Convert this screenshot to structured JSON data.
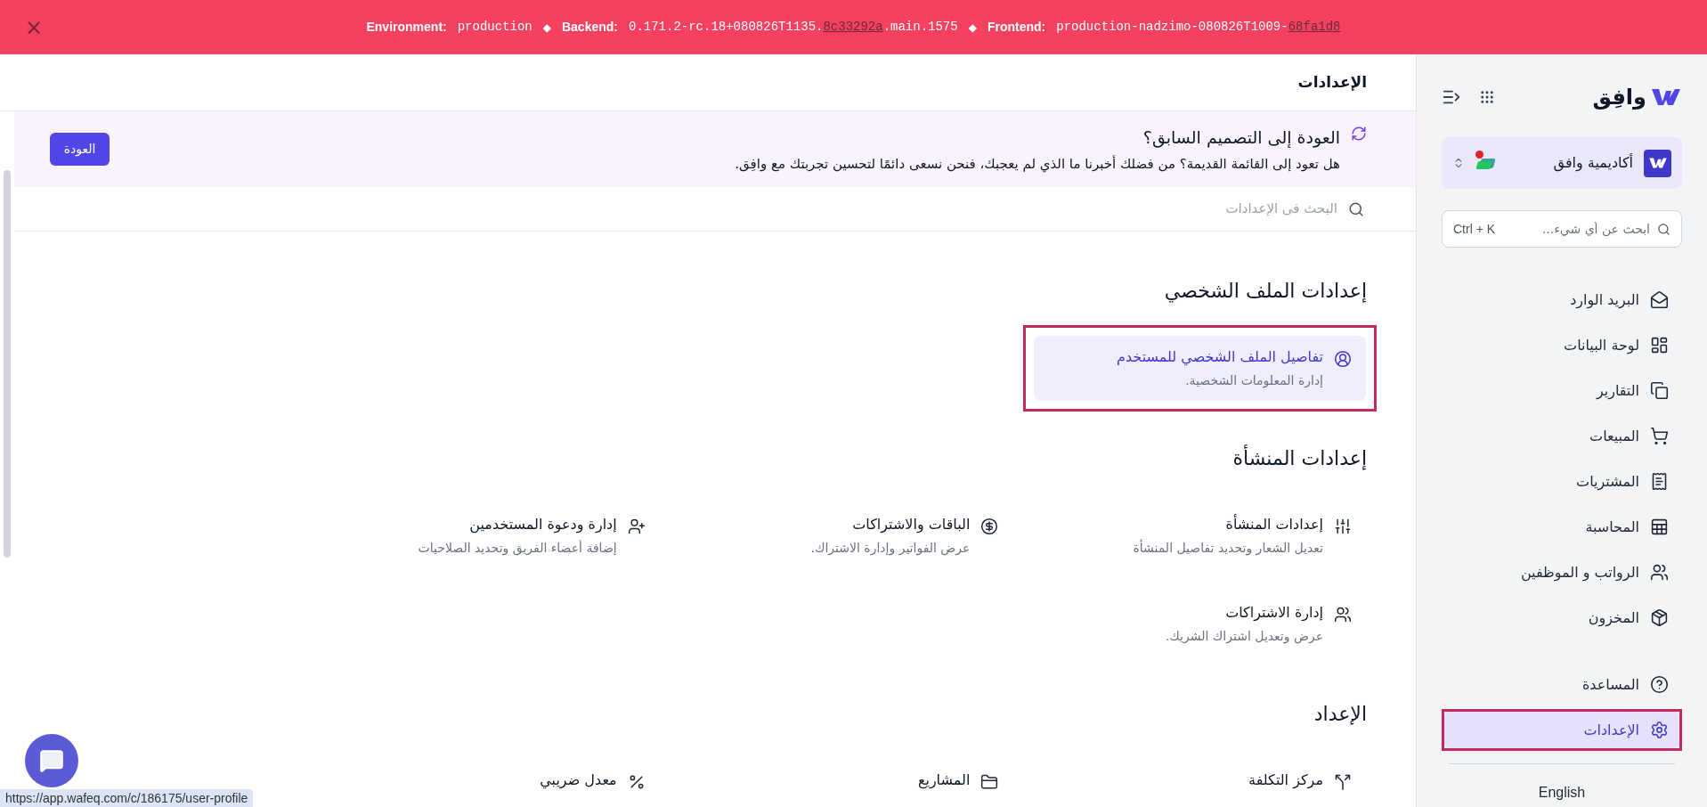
{
  "env_banner": {
    "close": "×",
    "separator": "◆",
    "environment": {
      "label": "Environment:",
      "value": "production"
    },
    "backend": {
      "label": "Backend:",
      "value": "0.171.2-rc.18+080826T1135.",
      "link": "8c33292a",
      "suffix": ".main.1575"
    },
    "frontend": {
      "label": "Frontend:",
      "value": "production-nadzimo-080826T1009-",
      "link": "68fa1d8"
    }
  },
  "sidebar": {
    "logo": "وافِق",
    "company": {
      "name": "أكاديمية وافق",
      "alert": true
    },
    "search": {
      "placeholder": "ابحث عن أي شيء...",
      "shortcut": "Ctrl + K"
    },
    "items": [
      {
        "label": "البريد الوارد",
        "selected": false,
        "highlighted": false
      },
      {
        "label": "لوحة البيانات",
        "selected": false,
        "highlighted": false
      },
      {
        "label": "التقارير",
        "selected": false,
        "highlighted": false
      },
      {
        "label": "المبيعات",
        "selected": false,
        "highlighted": false
      },
      {
        "label": "المشتريات",
        "selected": false,
        "highlighted": false
      },
      {
        "label": "المحاسبة",
        "selected": false,
        "highlighted": false
      },
      {
        "label": "الرواتب و الموظفين",
        "selected": false,
        "highlighted": false
      },
      {
        "label": "المخزون",
        "selected": false,
        "highlighted": false
      }
    ],
    "footer_items": [
      {
        "label": "المساعدة",
        "selected": false,
        "highlighted": false
      },
      {
        "label": "الإعدادات",
        "selected": true,
        "highlighted": true
      }
    ],
    "language": "English"
  },
  "page": {
    "title": "الإعدادات",
    "notice": {
      "title": "العودة إلى التصميم السابق؟",
      "text": "هل تعود إلى القائمة القديمة؟ من فضلك أخبرنا ما الذي لم يعجبك، فنحن نسعى دائمًا لتحسين تجربتك مع وافِق.",
      "button": "العودة"
    },
    "search": {
      "placeholder": "البحث فى الإعدادات"
    },
    "sections": [
      {
        "title": "إعدادات الملف الشخصي",
        "items": [
          {
            "title": "تفاصيل الملف الشخصي للمستخدم",
            "description": "إدارة المعلومات الشخصية.",
            "selected": true,
            "highlighted": true
          }
        ]
      },
      {
        "title": "إعدادات المنشأة",
        "items": [
          {
            "title": "إعدادات المنشأة",
            "description": "تعديل الشعار وتحديد تفاصيل المنشأة",
            "selected": false,
            "highlighted": false
          },
          {
            "title": "الباقات والاشتراكات",
            "description": "عرض الفواتير وإدارة الاشتراك.",
            "selected": false,
            "highlighted": false
          },
          {
            "title": "إدارة ودعوة المستخدمين",
            "description": "إضافة أعضاء الفريق وتحديد الصلاحيات",
            "selected": false,
            "highlighted": false
          },
          {
            "title": "إدارة الاشتراكات",
            "description": "عرض وتعديل اشتراك الشريك.",
            "selected": false,
            "highlighted": false
          }
        ]
      },
      {
        "title": "الإعداد",
        "items": [
          {
            "title": "مركز التكلفة",
            "selected": false,
            "highlighted": false
          },
          {
            "title": "المشاريع",
            "selected": false,
            "highlighted": false
          },
          {
            "title": "معدل ضريبي",
            "selected": false,
            "highlighted": false
          }
        ]
      }
    ]
  },
  "status_url": "https://app.wafeq.com/c/186175/user-profile"
}
